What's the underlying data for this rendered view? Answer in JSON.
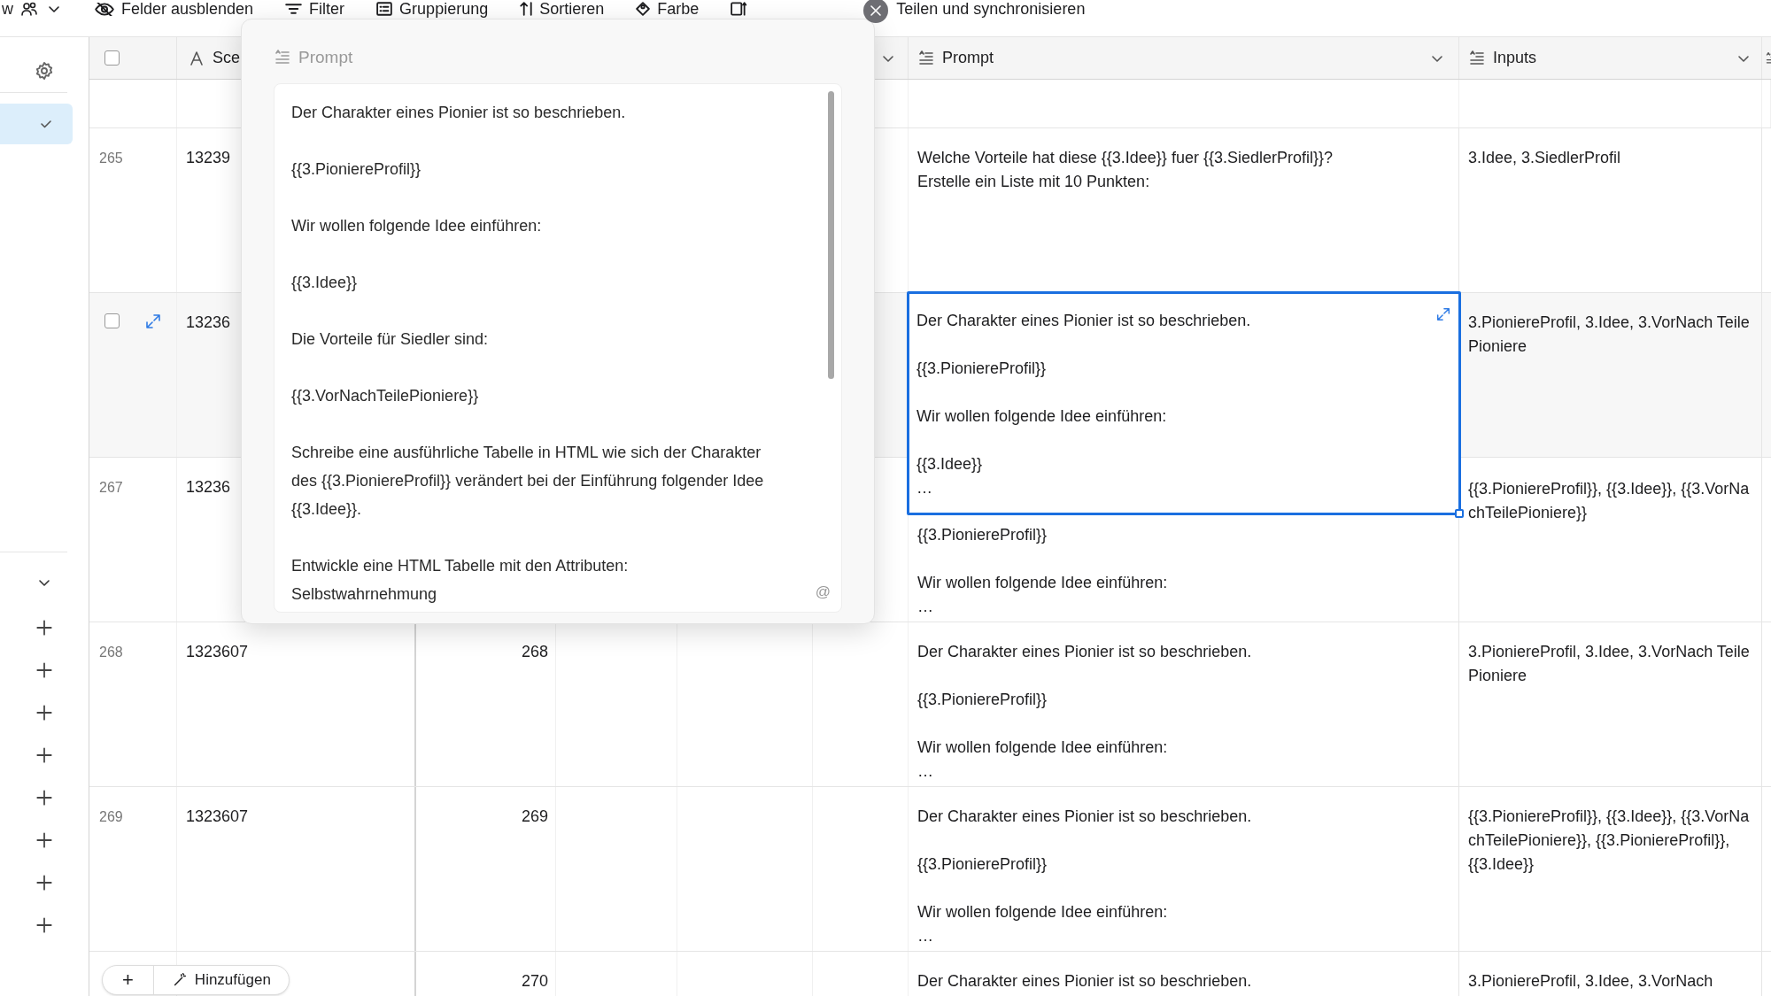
{
  "toolbar": {
    "view_name": "w",
    "items": [
      {
        "kind": "hide",
        "label": "Felder ausblenden"
      },
      {
        "kind": "filter",
        "label": "Filter"
      },
      {
        "kind": "group",
        "label": "Gruppierung"
      },
      {
        "kind": "sort",
        "label": "Sortieren"
      },
      {
        "kind": "color",
        "label": "Farbe"
      },
      {
        "kind": "height"
      },
      {
        "kind": "share",
        "label": "Teilen und synchronisieren"
      }
    ]
  },
  "sidebar": {
    "items": [
      {
        "selected": true
      }
    ]
  },
  "table": {
    "header_checkbox": {
      "checked": false
    },
    "columns": [
      {
        "label": "Sce",
        "kind": "text"
      },
      {
        "label": "Prompt",
        "kind": "longtext"
      },
      {
        "label": "Inputs",
        "kind": "longtext"
      }
    ],
    "rows": [
      {
        "row_number": "265",
        "hovered": false,
        "column_1": "13239",
        "number": "",
        "prompt": {
          "editing": false,
          "paragraphs": [
            "Welche Vorteile hat diese {{3.Idee}} fuer {{3.SiedlerProfil}}?\nErstelle ein Liste mit 10 Punkten:"
          ]
        },
        "inputs": "3.Idee, 3.SiedlerProfil"
      },
      {
        "row_number": "",
        "hovered": true,
        "checked": false,
        "column_1": "13236",
        "number": "",
        "prompt": {
          "editing": true,
          "paragraphs": [
            "Der Charakter eines Pionier ist so beschrieben.",
            "{{3.PioniereProfil}}",
            "Wir wollen folgende Idee einführen:",
            "{{3.Idee}}"
          ],
          "ellipsis": "…"
        },
        "inputs": "3.PioniereProfil, 3.Idee, 3.VorNach TeilePioniere"
      },
      {
        "row_number": "267",
        "hovered": false,
        "column_1": "13236",
        "number": "",
        "prompt": {
          "editing": false,
          "partly_covered": true,
          "paragraphs": [
            "{{3.PioniereProfil}}",
            "Wir wollen folgende Idee einführen:"
          ],
          "ellipsis": "…"
        },
        "inputs": "{{3.PioniereProfil}}, {{3.Idee}}, {{3.VorNachTeilePioniere}}"
      },
      {
        "row_number": "268",
        "hovered": false,
        "column_1": "1323607",
        "number": "268",
        "prompt": {
          "editing": false,
          "paragraphs": [
            "Der Charakter eines Pionier ist so beschrieben.",
            "{{3.PioniereProfil}}",
            "Wir wollen folgende Idee einführen:"
          ],
          "ellipsis": "…"
        },
        "inputs": "3.PioniereProfil, 3.Idee, 3.VorNach TeilePioniere"
      },
      {
        "row_number": "269",
        "hovered": false,
        "column_1": "1323607",
        "number": "269",
        "prompt": {
          "editing": false,
          "paragraphs": [
            "Der Charakter eines Pionier ist so beschrieben.",
            "{{3.PioniereProfil}}",
            "Wir wollen folgende Idee einführen:"
          ],
          "ellipsis": "…"
        },
        "inputs": "{{3.PioniereProfil}}, {{3.Idee}}, {{3.VorNachTeilePioniere}}, {{3.PioniereProfil}}, {{3.Idee}}"
      },
      {
        "number": "270",
        "prompt": {
          "editing": false,
          "paragraphs": [
            "Der Charakter eines Pionier ist so beschrieben."
          ]
        },
        "inputs": "3.PioniereProfil, 3.Idee, 3.VorNach"
      }
    ],
    "add_button": {
      "plus": "+",
      "label": "Hinzufügen"
    }
  },
  "popup": {
    "field_label": "Prompt",
    "paragraphs": [
      "Der Charakter eines Pionier ist so beschrieben.",
      "{{3.PioniereProfil}}",
      "Wir wollen folgende Idee einführen:",
      "{{3.Idee}}",
      "Die Vorteile für Siedler sind:",
      "{{3.VorNachTeilePioniere}}",
      "Schreibe eine ausführliche Tabelle in HTML wie sich der Charakter des {{3.PioniereProfil}} verändert bei der Einführung folgender Idee {{3.Idee}}.",
      "Entwickle eine HTML Tabelle mit den Attributen:\nSelbstwahrnehmung"
    ],
    "mention_button": "@"
  }
}
